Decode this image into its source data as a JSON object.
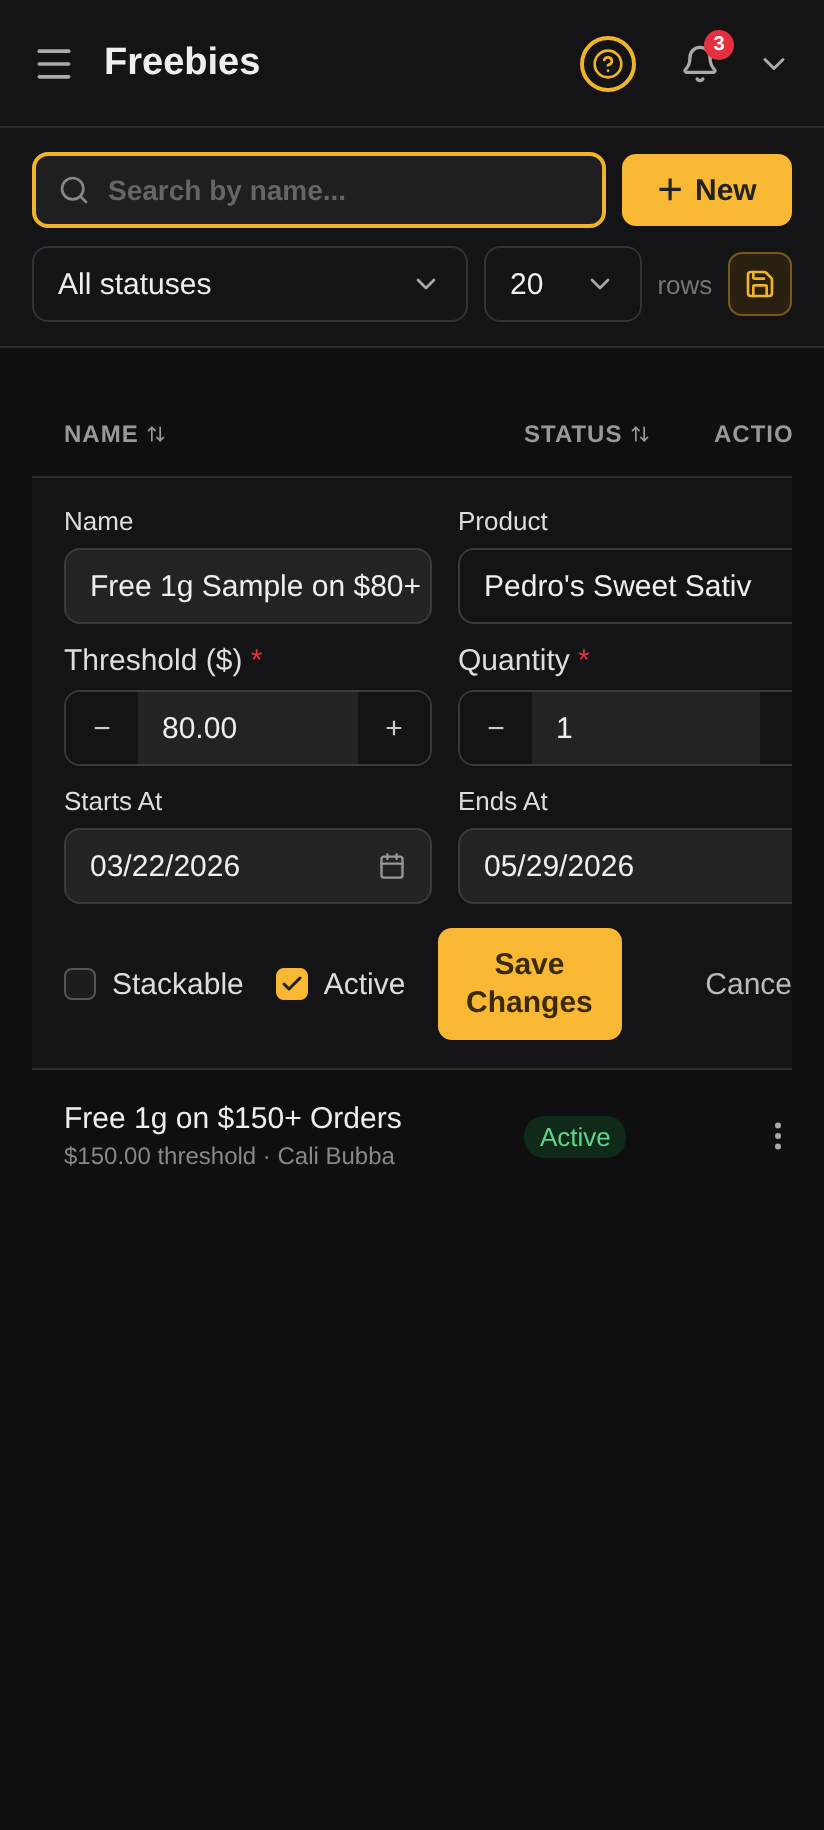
{
  "header": {
    "title": "Freebies",
    "notification_count": "3"
  },
  "toolbar": {
    "search": {
      "placeholder": "Search by name..."
    },
    "new_button": {
      "icon": "+",
      "label": "New"
    },
    "status_filter": {
      "value": "All statuses"
    },
    "page_size": {
      "value": "20"
    },
    "rows_label": "rows"
  },
  "table": {
    "columns": [
      {
        "label": "NAME",
        "sortable": true
      },
      {
        "label": "STATUS",
        "sortable": true
      },
      {
        "label": "ACTIO",
        "sortable": false
      }
    ],
    "edit_form": {
      "name": {
        "label": "Name",
        "value": "Free 1g Sample on $80+"
      },
      "product": {
        "label": "Product",
        "value": "Pedro's Sweet Sativ"
      },
      "threshold": {
        "label": "Threshold ($)",
        "required_mark": "*",
        "value": "80.00",
        "minus": "−",
        "plus": "+"
      },
      "quantity": {
        "label": "Quantity",
        "required_mark": "*",
        "value": "1",
        "minus": "−"
      },
      "starts_at": {
        "label": "Starts At",
        "value": "03/22/2026"
      },
      "ends_at": {
        "label": "Ends At",
        "value": "05/29/2026"
      },
      "checkboxes": [
        {
          "label": "Stackable",
          "checked": false
        },
        {
          "label": "Active",
          "checked": true
        }
      ],
      "save_button": "Save Changes",
      "cancel_button": "Cance"
    },
    "rows": [
      {
        "name": "Free 1g on $150+ Orders",
        "details": "$150.00 threshold · Cali Bubba",
        "status": "Active"
      }
    ]
  }
}
